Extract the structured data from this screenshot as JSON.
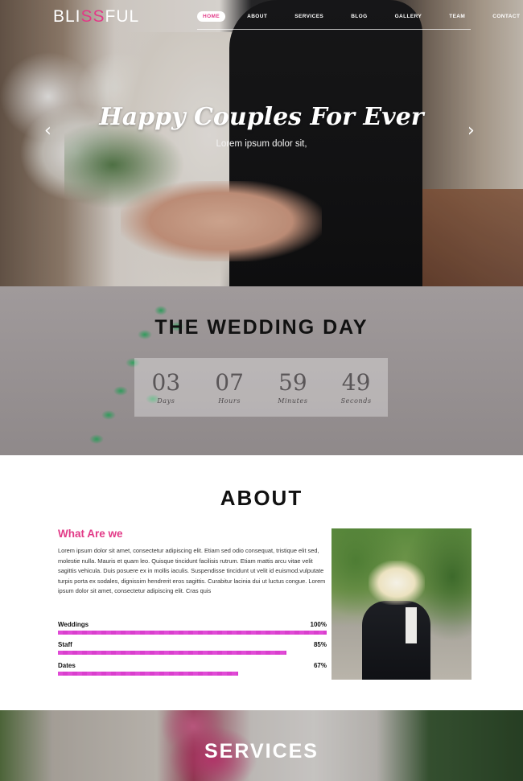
{
  "brand": {
    "logo_part1": "BLI",
    "logo_accent": "SS",
    "logo_part2": "FUL",
    "accent_color": "#e23a87"
  },
  "nav": {
    "items": [
      {
        "label": "HOME",
        "active": true
      },
      {
        "label": "ABOUT",
        "active": false
      },
      {
        "label": "SERVICES",
        "active": false
      },
      {
        "label": "BLOG",
        "active": false
      },
      {
        "label": "GALLERY",
        "active": false
      },
      {
        "label": "TEAM",
        "active": false
      },
      {
        "label": "CONTACT",
        "active": false
      }
    ]
  },
  "hero": {
    "title": "Happy Couples For Ever",
    "subtitle": "Lorem ipsum dolor sit,",
    "prev_icon": "chevron-left-icon",
    "next_icon": "chevron-right-icon"
  },
  "countdown": {
    "title": "THE WEDDING DAY",
    "units": [
      {
        "value": "03",
        "label": "Days"
      },
      {
        "value": "07",
        "label": "Hours"
      },
      {
        "value": "59",
        "label": "Minutes"
      },
      {
        "value": "49",
        "label": "Seconds"
      }
    ]
  },
  "about": {
    "title": "ABOUT",
    "heading": "What Are we",
    "text": "Lorem ipsum dolor sit amet, consectetur adipiscing elit. Etiam sed odio consequat, tristique elit sed, molestie nulla. Mauris et quam leo. Quisque tincidunt facilisis rutrum. Etiam mattis arcu vitae velit sagittis vehicula. Duis posuere ex in mollis iaculis. Suspendisse tincidunt ut velit id euismod.vulputate turpis porta ex sodales, dignissim hendrerit eros sagittis. Curabitur lacinia dui ut luctus congue. Lorem ipsum dolor sit amet, consectetur adipiscing elit. Cras quis",
    "skills": [
      {
        "label": "Weddings",
        "value": "100%",
        "fraction": 1.0
      },
      {
        "label": "Staff",
        "value": "85%",
        "fraction": 0.85
      },
      {
        "label": "Dates",
        "value": "67%",
        "fraction": 0.67
      }
    ],
    "bar_color": "#e04ad6"
  },
  "services": {
    "title": "SERVICES"
  }
}
